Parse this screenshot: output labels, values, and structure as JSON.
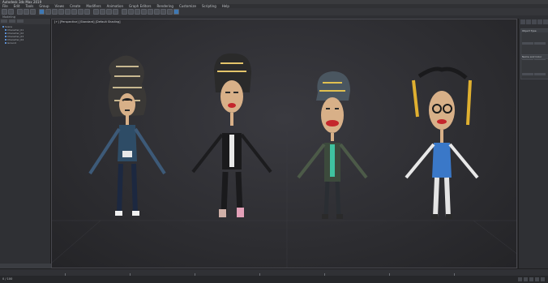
{
  "window": {
    "title": "Autodesk 3ds Max 2019"
  },
  "menu": [
    "File",
    "Edit",
    "Tools",
    "Group",
    "Views",
    "Create",
    "Modifiers",
    "Animation",
    "Graph Editors",
    "Rendering",
    "Customize",
    "Scripting",
    "Help"
  ],
  "ribbon": {
    "label": "Modeling"
  },
  "scene_explorer": {
    "items": [
      "Scene",
      "Character_01",
      "Character_02",
      "Character_03",
      "Character_04",
      "Ground"
    ]
  },
  "viewport": {
    "label": "[+] [Perspective] [Standard] [Default Shading]"
  },
  "command_panel": {
    "groups": [
      "Object Type",
      "Name and Color"
    ]
  },
  "status": {
    "left": "0 / 100",
    "right": ""
  },
  "colors": {
    "accent": "#3e78b4"
  }
}
